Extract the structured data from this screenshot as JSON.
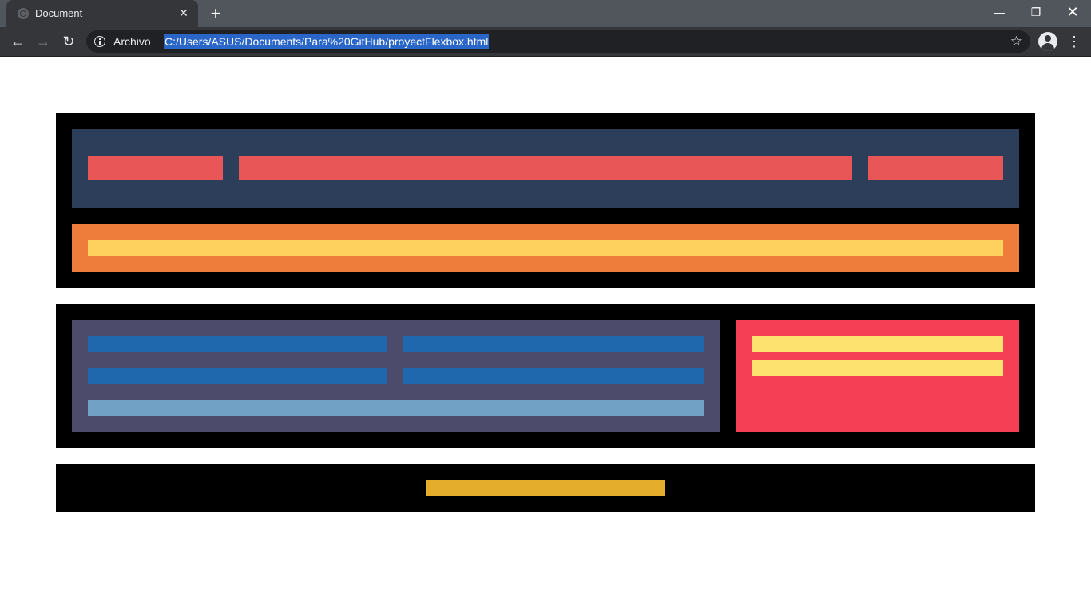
{
  "browser": {
    "tab_title": "Document",
    "scheme_label": "Archivo",
    "url": "C:/Users/ASUS/Documents/Para%20GitHub/proyectFlexbox.html"
  },
  "icons": {
    "tab_favicon": "globe-icon",
    "tab_close": "close-icon",
    "new_tab": "plus-icon",
    "back": "arrow-left-icon",
    "forward": "arrow-right-icon",
    "reload": "reload-icon",
    "site_info": "info-icon",
    "bookmark": "star-icon",
    "profile": "account-icon",
    "menu": "kebab-menu-icon",
    "minimize": "minimize-icon",
    "restore": "restore-icon",
    "close_window": "close-icon"
  },
  "colors": {
    "page_bg": "#ffffff",
    "container": "#000000",
    "header_bg": "#2c3e5a",
    "nav_item": "#e85657",
    "banner_bg": "#ee7d3c",
    "banner_bar": "#fed15f",
    "main_bg": "#4c4b6b",
    "grid_item": "#1f68ad",
    "grid_wide": "#71a2c5",
    "aside_bg": "#f43f55",
    "aside_item": "#fee270",
    "footer_bar": "#e4ae2c",
    "chrome_tabbar": "#51565c",
    "chrome_toolbar": "#35363a",
    "url_highlight": "#2a66c8"
  }
}
